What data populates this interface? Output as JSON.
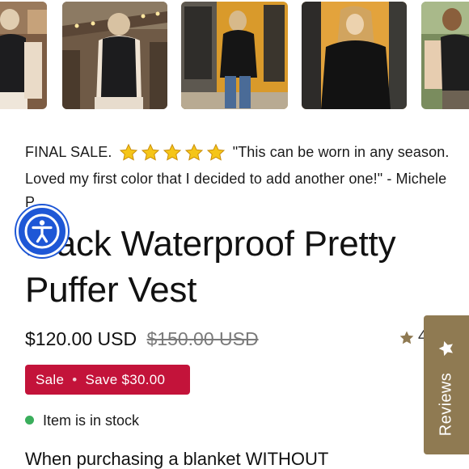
{
  "gallery": {
    "thumbnails": [
      {
        "id": "thumb-1",
        "icon": "vest-back-photo"
      },
      {
        "id": "thumb-2",
        "icon": "vest-back-photo"
      },
      {
        "id": "thumb-3",
        "icon": "vest-street-photo"
      },
      {
        "id": "thumb-4",
        "icon": "vest-front-photo"
      },
      {
        "id": "thumb-5",
        "icon": "vest-side-photo"
      }
    ]
  },
  "review": {
    "prefix": "FINAL SALE.",
    "star_count": 5,
    "quote": "\"This can be worn in any season. Loved my first color that I decided to add another one!\" - Michele P."
  },
  "product": {
    "title": "Black Waterproof Pretty Puffer Vest",
    "price": "$120.00 USD",
    "compare_price": "$150.00 USD",
    "rating_peek": "4"
  },
  "badge": {
    "sale": "Sale",
    "separator": "•",
    "save": "Save $30.00"
  },
  "stock": {
    "text": "Item is in stock"
  },
  "description": {
    "text": "When purchasing a blanket WITHOUT"
  },
  "reviews_tab": {
    "label": "Reviews"
  },
  "colors": {
    "sale_badge": "#c3133a",
    "in_stock": "#3aae5c",
    "reviews_tab": "#8f7a52",
    "accessibility": "#1e57d6",
    "star": "#f5c518"
  }
}
